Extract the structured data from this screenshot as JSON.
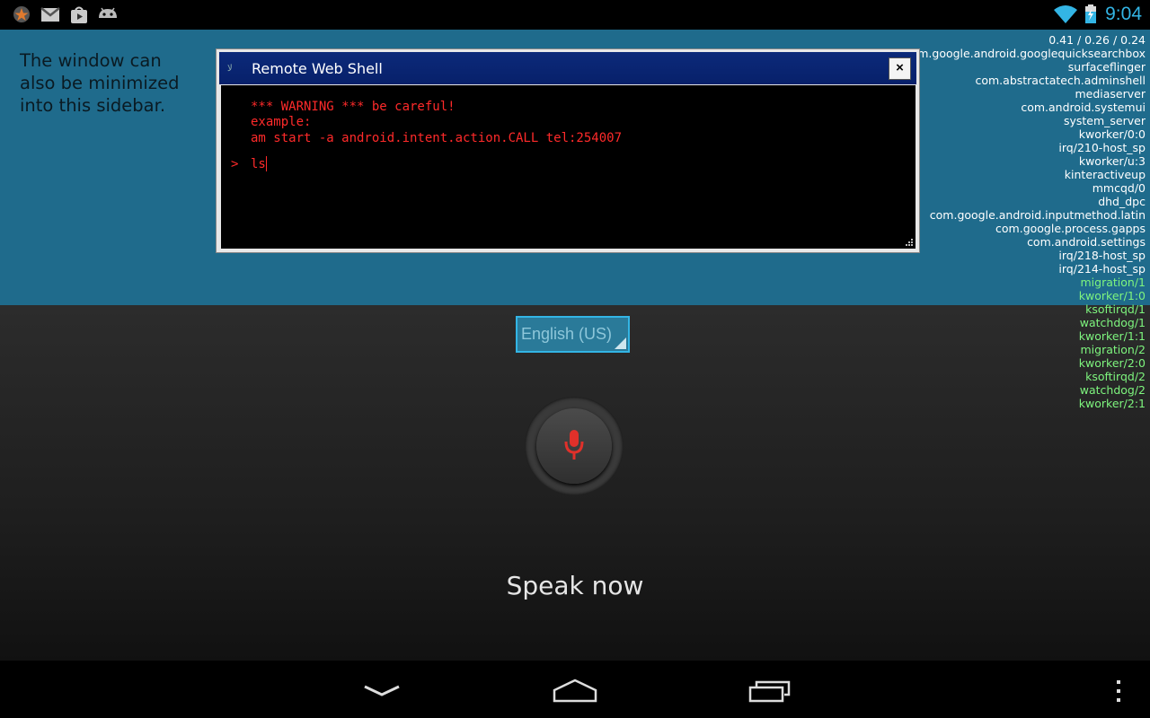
{
  "status_bar": {
    "time": "9:04",
    "left_icons": [
      "star-icon",
      "gmail-icon",
      "play-store-icon",
      "android-icon"
    ],
    "right_icons": [
      "wifi-icon",
      "battery-charging-icon"
    ],
    "accent": "#33b5e5"
  },
  "desktop": {
    "sidebar_note": "The window can also be minimized into this sidebar.",
    "background": "#1f6b8c"
  },
  "shell_window": {
    "title": "Remote Web Shell",
    "close_label": "×",
    "lines": [
      "*** WARNING *** be careful!",
      "example:",
      "am start -a android.intent.action.CALL tel:254007"
    ],
    "prompt": ">",
    "input_value": "ls",
    "text_color": "#ff2a2a"
  },
  "voice_search": {
    "language": "English (US)",
    "speak_prompt": "Speak now",
    "mic_icon": "microphone-icon"
  },
  "process_overlay": {
    "load": "0.41 / 0.26 / 0.24",
    "processes": [
      {
        "name": "com.google.android.googlequicksearchbox",
        "color": "white"
      },
      {
        "name": "surfaceflinger",
        "color": "white"
      },
      {
        "name": "com.abstractatech.adminshell",
        "color": "white"
      },
      {
        "name": "mediaserver",
        "color": "white"
      },
      {
        "name": "com.android.systemui",
        "color": "white"
      },
      {
        "name": "system_server",
        "color": "white"
      },
      {
        "name": "kworker/0:0",
        "color": "white"
      },
      {
        "name": "irq/210-host_sp",
        "color": "white"
      },
      {
        "name": "kworker/u:3",
        "color": "white"
      },
      {
        "name": "kinteractiveup",
        "color": "white"
      },
      {
        "name": "mmcqd/0",
        "color": "white"
      },
      {
        "name": "dhd_dpc",
        "color": "white"
      },
      {
        "name": "com.google.android.inputmethod.latin",
        "color": "white"
      },
      {
        "name": "com.google.process.gapps",
        "color": "white"
      },
      {
        "name": "com.android.settings",
        "color": "white"
      },
      {
        "name": "irq/218-host_sp",
        "color": "white"
      },
      {
        "name": "irq/214-host_sp",
        "color": "white"
      },
      {
        "name": "migration/1",
        "color": "green"
      },
      {
        "name": "kworker/1:0",
        "color": "green"
      },
      {
        "name": "ksoftirqd/1",
        "color": "green"
      },
      {
        "name": "watchdog/1",
        "color": "green"
      },
      {
        "name": "kworker/1:1",
        "color": "green"
      },
      {
        "name": "migration/2",
        "color": "green"
      },
      {
        "name": "kworker/2:0",
        "color": "green"
      },
      {
        "name": "ksoftirqd/2",
        "color": "green"
      },
      {
        "name": "watchdog/2",
        "color": "green"
      },
      {
        "name": "kworker/2:1",
        "color": "green"
      }
    ]
  },
  "nav_bar": {
    "buttons": [
      "back-icon",
      "home-icon",
      "recent-apps-icon",
      "overflow-menu-icon"
    ]
  }
}
